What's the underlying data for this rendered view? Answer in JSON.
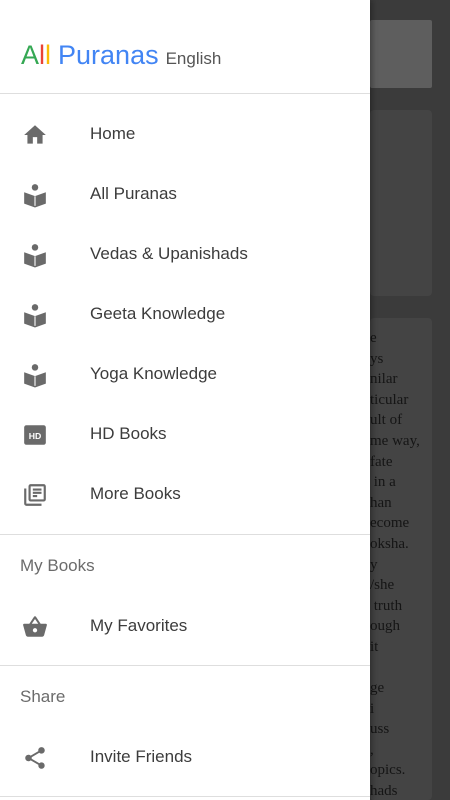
{
  "app": {
    "logo_part1": "All",
    "logo_part2": "Puranas",
    "logo_sub": "English",
    "colors": {
      "logo_A": "#34A853",
      "logo_l1": "#EA4335",
      "logo_l2": "#FBBC05",
      "logo_word": "#4285F4",
      "icon": "#6a6a6a"
    }
  },
  "menu": [
    {
      "label": "Home",
      "icon": "home-icon"
    },
    {
      "label": "All Puranas",
      "icon": "book-reader-icon"
    },
    {
      "label": "Vedas & Upanishads",
      "icon": "book-reader-icon"
    },
    {
      "label": "Geeta Knowledge",
      "icon": "book-reader-icon"
    },
    {
      "label": "Yoga Knowledge",
      "icon": "book-reader-icon"
    },
    {
      "label": "HD Books",
      "icon": "hd-icon"
    },
    {
      "label": "More Books",
      "icon": "library-books-icon"
    }
  ],
  "sections": {
    "my_books": {
      "title": "My Books",
      "items": [
        {
          "label": "My Favorites",
          "icon": "basket-icon"
        }
      ]
    },
    "share": {
      "title": "Share",
      "items": [
        {
          "label": "Invite Friends",
          "icon": "share-icon"
        }
      ]
    }
  },
  "background_text": "e\nys\nnilar\nticular\nult of\nme way,\nfate\n in a\nhan\necome\noksha.\ny\n/she\n truth\nough\nit\n\nge\ni\nuss\n,\nopics.\nhads"
}
